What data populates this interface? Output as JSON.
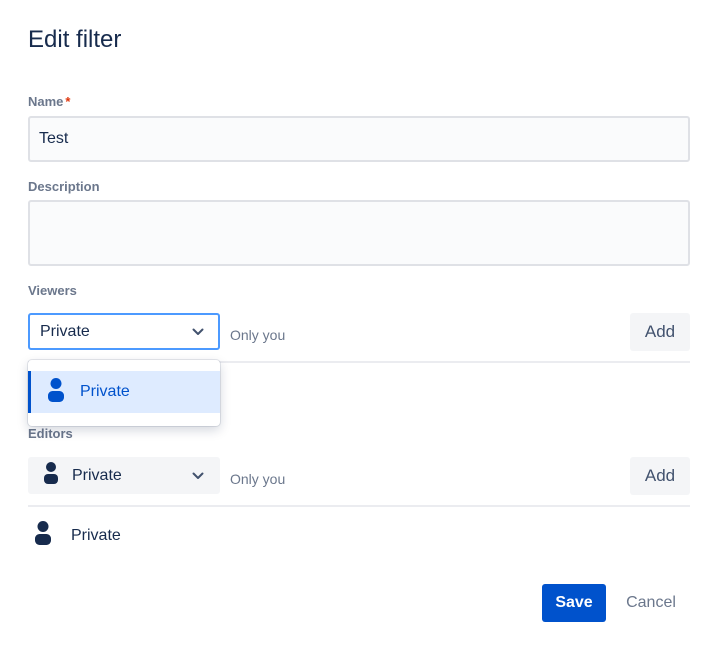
{
  "dialog": {
    "title": "Edit filter"
  },
  "name": {
    "label": "Name",
    "required_marker": "*",
    "value": "Test"
  },
  "description": {
    "label": "Description",
    "value": ""
  },
  "viewers": {
    "label": "Viewers",
    "selected": "Private",
    "hint": "Only you",
    "add_label": "Add",
    "dropdown_open": true,
    "options": [
      {
        "label": "Private",
        "icon": "person-icon",
        "highlighted": true
      }
    ]
  },
  "editors": {
    "label": "Editors",
    "selected": "Private",
    "hint": "Only you",
    "add_label": "Add",
    "items": [
      {
        "label": "Private",
        "icon": "person-icon"
      }
    ]
  },
  "actions": {
    "save_label": "Save",
    "cancel_label": "Cancel"
  },
  "colors": {
    "primary": "#0052cc",
    "focus_border": "#4c9aff",
    "option_highlight": "#deebff",
    "text": "#172b4d",
    "subtle_text": "#6b778c",
    "required": "#de350b"
  }
}
